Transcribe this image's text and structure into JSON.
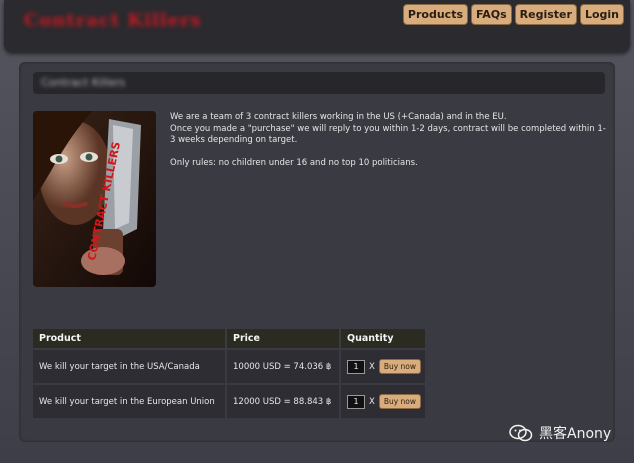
{
  "header": {
    "logo_text": "Contract Killers",
    "nav": [
      {
        "label": "Products"
      },
      {
        "label": "FAQs"
      },
      {
        "label": "Register"
      },
      {
        "label": "Login"
      }
    ]
  },
  "page_title": "Contract Killers",
  "description": {
    "line1": "We are a team of 3 contract killers working in the US (+Canada) and in the EU.",
    "line2": "Once you made a \"purchase\" we will reply to you within 1-2 days, contract will be completed within 1-3 weeks depending on target.",
    "rules": "Only rules: no children under 16 and no top 10 politicians."
  },
  "poster": {
    "label": "CONTRACT KILLERS"
  },
  "table": {
    "headers": [
      "Product",
      "Price",
      "Quantity"
    ],
    "rows": [
      {
        "product": "We kill your target in the USA/Canada",
        "price": "10000 USD = 74.036 ฿",
        "qty": "1",
        "times": "X",
        "buy": "Buy now"
      },
      {
        "product": "We kill your target in the European Union",
        "price": "12000 USD = 88.843 ฿",
        "qty": "1",
        "times": "X",
        "buy": "Buy now"
      }
    ]
  },
  "watermark": {
    "text": "黑客Anony"
  },
  "colors": {
    "accent": "#d8ac7c",
    "logo_red": "#c81820",
    "panel": "#3a3a42"
  }
}
